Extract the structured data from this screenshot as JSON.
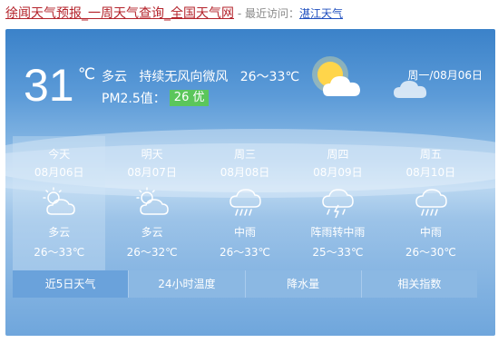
{
  "topbar": {
    "title": "徐闻天气预报_一周天气查询_全国天气网",
    "separator": " - ",
    "recent_label": "最近访问：",
    "recent_city": "湛江天气"
  },
  "current": {
    "temp": "31",
    "unit": "℃",
    "weather": "多云",
    "wind": "持续无风向微风",
    "range": "26～33℃",
    "pm_label": "PM2.5值：",
    "pm_value": "26 优",
    "date": "周一/08月06日"
  },
  "forecast": [
    {
      "name": "今天",
      "date": "08月06日",
      "icon": "partly-cloudy-icon",
      "weather": "多云",
      "temp": "26～33℃"
    },
    {
      "name": "明天",
      "date": "08月07日",
      "icon": "partly-cloudy-icon",
      "weather": "多云",
      "temp": "26～32℃"
    },
    {
      "name": "周三",
      "date": "08月08日",
      "icon": "rain-cloud-icon",
      "weather": "中雨",
      "temp": "26～33℃"
    },
    {
      "name": "周四",
      "date": "08月09日",
      "icon": "thunder-rain-icon",
      "weather": "阵雨转中雨",
      "temp": "25～33℃"
    },
    {
      "name": "周五",
      "date": "08月10日",
      "icon": "rain-cloud-icon",
      "weather": "中雨",
      "temp": "26～30℃"
    }
  ],
  "tabs": [
    "近5日天气",
    "24小时温度",
    "降水量",
    "相关指数"
  ],
  "colors": {
    "title_red": "#b4232b",
    "link_blue": "#1f4fbf",
    "pm_green": "#5bc65b",
    "sky_blue": "#3b82c9"
  }
}
